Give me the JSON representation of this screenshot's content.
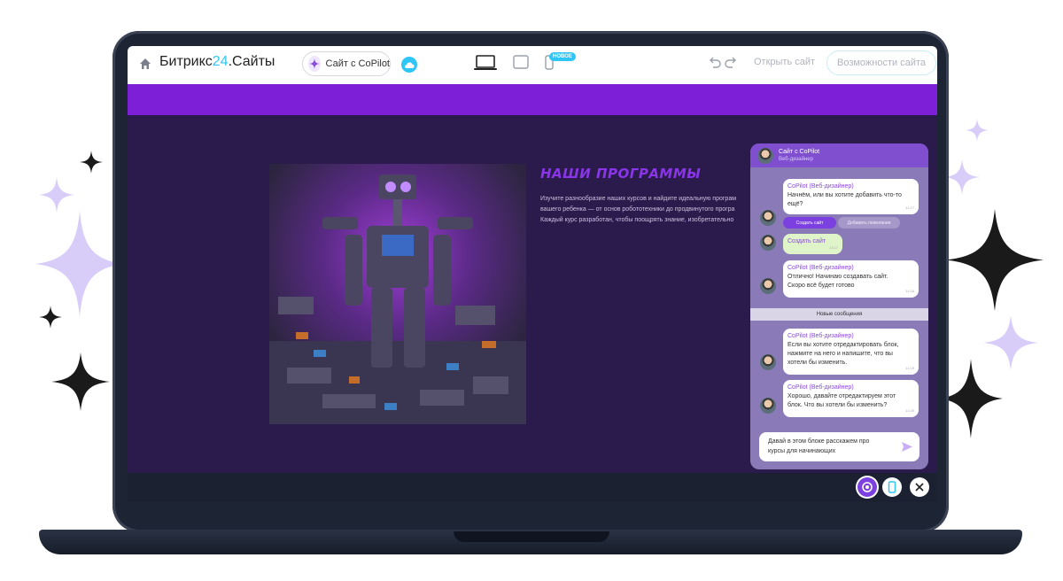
{
  "topbar": {
    "brand_prefix": "Битрикс",
    "brand_accent": "24",
    "brand_suffix": ".Сайты",
    "copilot_button": "Сайт с CoPilot",
    "new_badge": "НОВОЕ",
    "open_site": "Открыть сайт",
    "site_features": "Возможности сайта"
  },
  "content": {
    "title": "НАШИ ПРОГРАММЫ",
    "text_lines": [
      "Изучите разнообразие наших курсов и найдите идеальную програм",
      "вашего ребенка — от основ робототехники до продвинутого програ",
      "Каждый курс разработан, чтобы поощрять знание, изобретательно"
    ]
  },
  "chat": {
    "header_title": "Сайт с CoPilot",
    "header_subtitle": "Веб-дизайнер",
    "messages": [
      {
        "author": "CoPilot (Веб-дизайнер)",
        "lines": [
          "Начнём, или вы хотите добавить что-то",
          "ещё?"
        ],
        "time": "11:17"
      },
      {
        "text": "Создать сайт",
        "time": "11:17"
      },
      {
        "author": "CoPilot (Веб-дизайнер)",
        "lines": [
          "Отлично! Начинаю создавать сайт.",
          "Скоро всё будет готово"
        ],
        "time": "11:18"
      },
      {
        "author": "CoPilot (Веб-дизайнер)",
        "lines": [
          "Если вы хотите отредактировать блок,",
          "нажмите на него и напишите, что вы",
          "хотели бы изменить."
        ],
        "time": "11:19"
      },
      {
        "author": "CoPilot (Веб-дизайнер)",
        "lines": [
          "Хорошо, давайте отредактируем этот",
          "блок. Что вы хотели бы изменить?"
        ],
        "time": "11:20"
      }
    ],
    "action_create": "Создать сайт",
    "action_add_wishes": "Добавить пожелания",
    "new_messages": "Новые сообщения",
    "input_lines": [
      "Давай в этом блоке расскажем про",
      "курсы для начинающих"
    ]
  },
  "colors": {
    "accent_purple": "#7c1fd6",
    "brand_blue": "#2fc6f6",
    "screen_bg": "#2a1b4c"
  },
  "icons": [
    "home-icon",
    "sparkle-icon",
    "cloud-icon",
    "laptop-icon",
    "tablet-icon",
    "phone-icon",
    "undo-icon",
    "redo-icon",
    "send-icon",
    "copilot-icon",
    "mobile-icon",
    "close-icon"
  ]
}
